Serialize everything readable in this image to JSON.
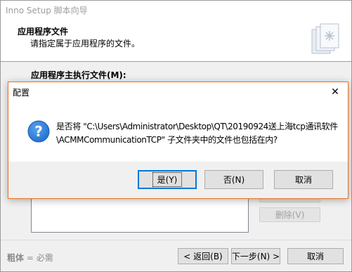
{
  "wizard": {
    "title": "Inno Setup 脚本向导",
    "header_title": "应用程序文件",
    "header_subtitle": "请指定属于应用程序的文件。",
    "main_exe_label": "应用程序主执行文件(M):",
    "remove_button": "删除(V)",
    "footer_note": "= 必需",
    "footer_note_bold": "粗体",
    "back_button": "< 返回(B)",
    "next_button": "下一步(N) >",
    "cancel_button": "取消"
  },
  "dialog": {
    "title": "配置",
    "message_line1": "是否将 \"C:\\Users\\Administrator\\Desktop\\QT\\20190924送上海tcp通讯软件",
    "message_line2": "\\ACMMCommunicationTCP\" 子文件夹中的文件也包括在内?",
    "yes_button": "是(Y)",
    "no_button": "否(N)",
    "cancel_button": "取消",
    "close_glyph": "✕",
    "icon": "question-icon"
  },
  "colors": {
    "dialog_border": "#e8742a",
    "default_button_border": "#0078d7",
    "question_icon": "#1f6fd0"
  }
}
